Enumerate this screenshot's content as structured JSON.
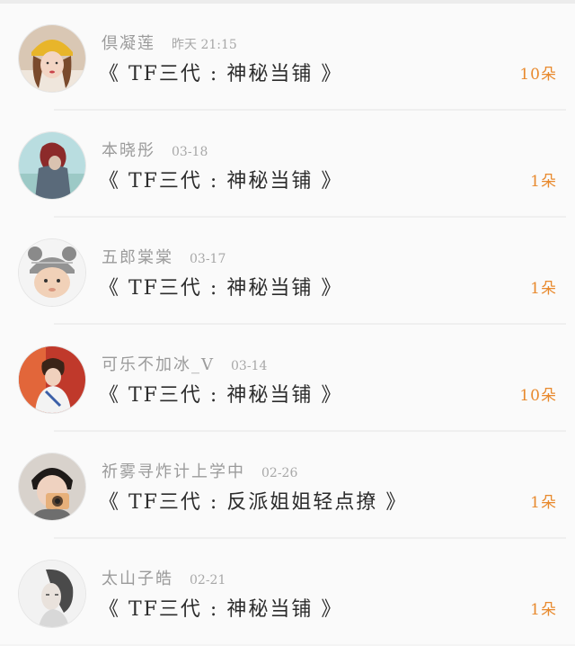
{
  "records": [
    {
      "username": "倶凝莲",
      "time": "昨天 21:15",
      "title": "《 TF三代 : 神秘当铺 》",
      "count": "10朵",
      "avatar_icon": "avatar-girl-yellow-hat"
    },
    {
      "username": "本晓彤",
      "time": "03-18",
      "title": "《 TF三代 : 神秘当铺 》",
      "count": "1朵",
      "avatar_icon": "avatar-anime-red-hair"
    },
    {
      "username": "五郎棠棠",
      "time": "03-17",
      "title": "《 TF三代 : 神秘当铺 》",
      "count": "1朵",
      "avatar_icon": "avatar-baby-bear-hat"
    },
    {
      "username": "可乐不加冰_V",
      "time": "03-14",
      "title": "《 TF三代 : 神秘当铺 》",
      "count": "10朵",
      "avatar_icon": "avatar-boy-red-background"
    },
    {
      "username": "祈雾寻炸计上学中",
      "time": "02-26",
      "title": "《 TF三代 : 反派姐姐轻点撩 》",
      "count": "1朵",
      "avatar_icon": "avatar-boy-camera"
    },
    {
      "username": "太山子皓",
      "time": "02-21",
      "title": "《 TF三代 : 神秘当铺 》",
      "count": "1朵",
      "avatar_icon": "avatar-girl-sketch"
    }
  ],
  "colors": {
    "count": "#e8892d",
    "title": "#2c2c2c",
    "meta": "#9b9b9b"
  }
}
